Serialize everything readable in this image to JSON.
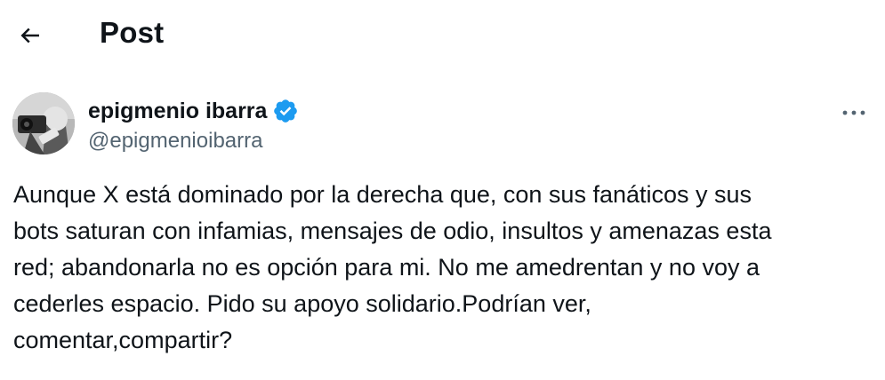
{
  "header": {
    "back_icon": "arrow-left-icon",
    "title": "Post"
  },
  "post": {
    "author": {
      "display_name": "epigmenio ibarra",
      "handle": "@epigmenioibarra",
      "verified": true,
      "verified_icon": "verified-badge-icon",
      "verified_color": "#1d9bf0"
    },
    "more_icon": "more-horizontal-icon",
    "text": "Aunque X está dominado por la derecha que, con sus fanáticos y sus\nbots saturan con infamias, mensajes de odio, insultos y amenazas esta\nred; abandonarla no es opción para mi. No me amedrentan y no voy a\ncederles espacio. Pido su apoyo solidario.Podrían ver,\ncomentar,compartir?"
  }
}
